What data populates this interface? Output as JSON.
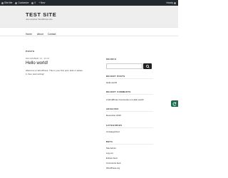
{
  "admin_bar": {
    "items": [
      "Site title",
      "Customize",
      "0",
      "+ New"
    ],
    "right": "Howdy"
  },
  "header": {
    "title": "TEST SITE",
    "description": "Just another WordPress site"
  },
  "nav": {
    "items": [
      "Home",
      "About",
      "Contact"
    ]
  },
  "main": {
    "section_label": "POSTS",
    "post": {
      "date": "DECEMBER 12, 2019",
      "title": "Hello world!",
      "excerpt": "Welcome to WordPress. This is your first post. Edit or delete it, then start writing!"
    }
  },
  "sidebar": {
    "search": {
      "title": "SEARCH",
      "placeholder": "",
      "button_icon": "search-icon"
    },
    "recent_posts": {
      "title": "RECENT POSTS",
      "items": [
        "Hello world!"
      ]
    },
    "recent_comments": {
      "title": "RECENT COMMENTS",
      "items": [
        "A WordPress Commenter on Hello world!"
      ]
    },
    "archives": {
      "title": "ARCHIVES",
      "items": [
        "December 2019"
      ]
    },
    "categories": {
      "title": "CATEGORIES",
      "items": [
        "Uncategorized"
      ]
    },
    "meta": {
      "title": "META",
      "items": [
        "Site Admin",
        "Log out",
        "Entries feed",
        "Comments feed",
        "WordPress.org"
      ]
    }
  },
  "colors": {
    "admin_bar": "#23282d",
    "header_bg": "#eeeeee",
    "side_tab": "#1a6b52"
  }
}
